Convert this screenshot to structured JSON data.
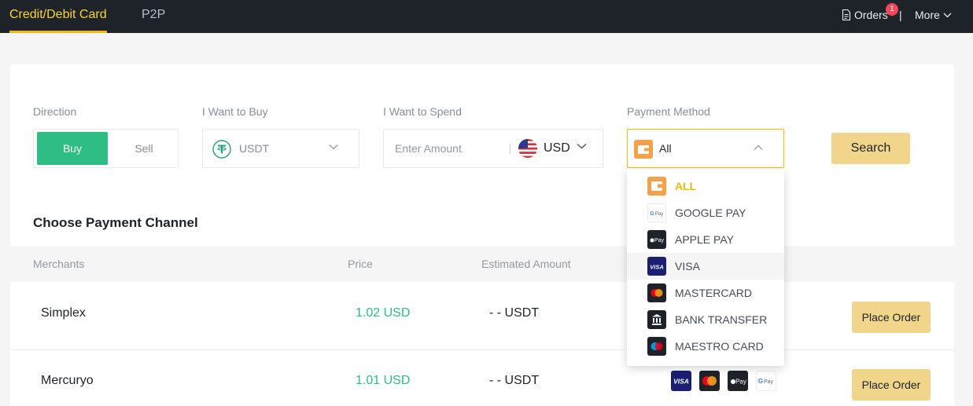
{
  "nav": {
    "tabs": [
      {
        "label": "Credit/Debit Card",
        "active": true
      },
      {
        "label": "P2P",
        "active": false
      }
    ],
    "orders_label": "Orders",
    "orders_badge": "1",
    "separator": "|",
    "more_label": "More"
  },
  "form": {
    "direction_label": "Direction",
    "buy_label": "Buy",
    "sell_label": "Sell",
    "want_buy_label": "I Want to Buy",
    "want_buy_value": "USDT",
    "want_spend_label": "I Want to Spend",
    "amount_placeholder": "Enter Amount",
    "currency": "USD",
    "payment_method_label": "Payment Method",
    "payment_method_value": "All",
    "search_label": "Search"
  },
  "dropdown": {
    "items": [
      {
        "label": "ALL",
        "icon": "wallet-icon",
        "selected": true
      },
      {
        "label": "GOOGLE PAY",
        "icon": "google-pay-icon"
      },
      {
        "label": "APPLE PAY",
        "icon": "apple-pay-icon"
      },
      {
        "label": "VISA",
        "icon": "visa-icon",
        "hovered": true
      },
      {
        "label": "MASTERCARD",
        "icon": "mastercard-icon"
      },
      {
        "label": "BANK TRANSFER",
        "icon": "bank-transfer-icon"
      },
      {
        "label": "MAESTRO CARD",
        "icon": "maestro-icon"
      }
    ]
  },
  "channel": {
    "title": "Choose Payment Channel",
    "columns": [
      "Merchants",
      "Price",
      "Estimated Amount"
    ],
    "rows": [
      {
        "merchant": "Simplex",
        "price": "1.02 USD",
        "estimated": "- - USDT",
        "action": "Place Order"
      },
      {
        "merchant": "Mercuryo",
        "price": "1.01 USD",
        "estimated": "- - USDT",
        "action": "Place Order"
      }
    ],
    "row_icons": [
      "visa-icon",
      "mastercard-icon",
      "apple-pay-icon",
      "google-pay-icon"
    ]
  },
  "colors": {
    "nav_bg": "#1e2329",
    "accent": "#f0b90b",
    "buy_green": "#2ebd85",
    "button_yellow": "#f0d58a"
  }
}
